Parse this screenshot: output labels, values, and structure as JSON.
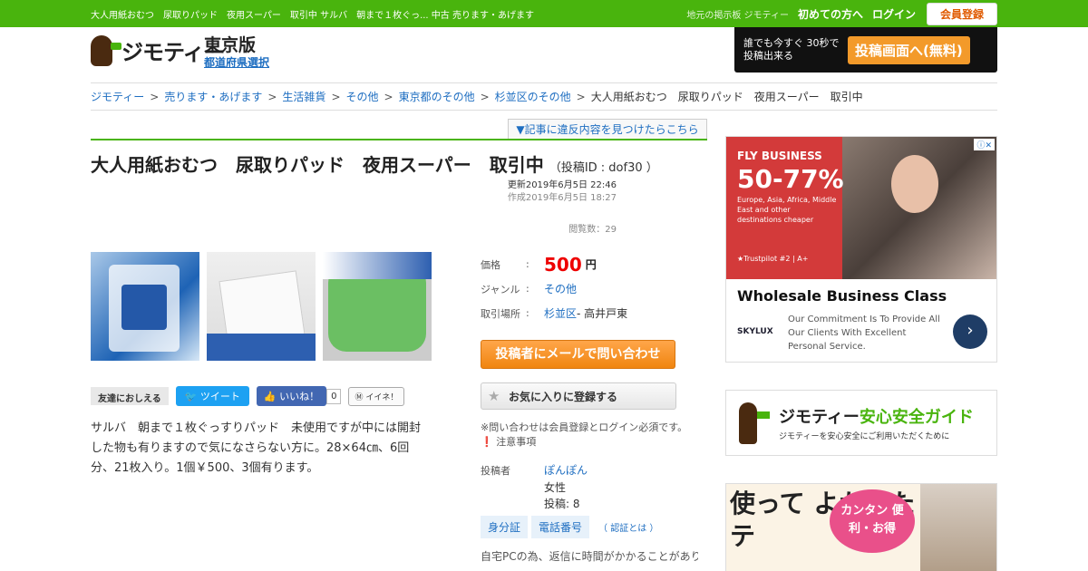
{
  "topbar": {
    "breadcrumb_text": "大人用紙おむつ　尿取りパッド　夜用スーパー　取引中 サルバ　朝まで１枚ぐっ... 中古 売ります・あげます",
    "site_label": "地元の掲示板 ジモティー",
    "beginner_label": "初めての方へ",
    "login_label": "ログイン",
    "register_label": "会員登録"
  },
  "header": {
    "logo_text": "ジモティー",
    "prefecture": "東京版",
    "change_prefecture": "都道府県選択",
    "post_promo": "誰でも今すぐ 30秒で投稿出来る",
    "post_button": "投稿画面へ(無料)"
  },
  "breadcrumb": {
    "items": [
      "ジモティー",
      "売ります・あげます",
      "生活雑貨",
      "その他",
      "東京都のその他",
      "杉並区のその他"
    ],
    "separator": ">",
    "current": "大人用紙おむつ　尿取りパッド　夜用スーパー　取引中"
  },
  "report_link": "▼記事に違反内容を見つけたらこちら",
  "listing": {
    "title": "大人用紙おむつ　尿取りパッド　夜用スーパー　取引中",
    "post_id": "（投稿ID : dof30 ）",
    "updated": "更新2019年6月5日 22:46",
    "created": "作成2019年6月5日 18:27",
    "views": "閲覧数：29",
    "description": "サルバ　朝まで１枚ぐっすりパッド　未使用ですが中には開封した物も有りますので気になさらない方に。28×64㎝、6回分、21枚入り。1個￥500、3個有ります。"
  },
  "share": {
    "label": "友達におしえる",
    "tweet": "ツイート",
    "like": "いいね！",
    "like_count": "0",
    "iine": "イイネ！"
  },
  "info": {
    "colon": ":",
    "price_label": "価格",
    "price": "500",
    "price_unit": "円",
    "genre_label": "ジャンル",
    "genre": "その他",
    "place_label": "取引場所",
    "place_link": "杉並区",
    "place_rest": " - 高井戸東",
    "mail_button": "投稿者にメールで問い合わせ",
    "fav_button": "お気に入りに登録する",
    "note1": "※問い合わせは会員登録とログイン必須です。",
    "note2": "注意事項"
  },
  "poster": {
    "label": "投稿者",
    "name": "ぽんぽん",
    "gender": "女性",
    "posts": "投稿: 8",
    "badge_id": "身分証",
    "badge_phone": "電話番号",
    "what": "（ 認証とは ）",
    "pc_note": "自宅PCの為、返信に時間がかかることがあります。最寄り駅は京王井の頭線高井"
  },
  "ad1": {
    "brand": "FLY BUSINESS",
    "discount": "50-77%",
    "sub": "Europe, Asia, Africa, Middle East and other destinations cheaper",
    "trustpilot": "★Trustpilot #2 | A+",
    "headline": "Wholesale Business Class",
    "logo": "SKYLUX",
    "copy": "Our Commitment Is To Provide All Our Clients With Excellent Personal Service.",
    "go": "›",
    "adchoice": "ⓘ✕"
  },
  "ad2": {
    "brand": "ジモティー",
    "title": "安心安全ガイド",
    "sub": "ジモティーを安心安全にご利用いただくために"
  },
  "ad3": {
    "headline": "使って よかった ジモテ",
    "bubble": "カンタン 便利・お得"
  }
}
